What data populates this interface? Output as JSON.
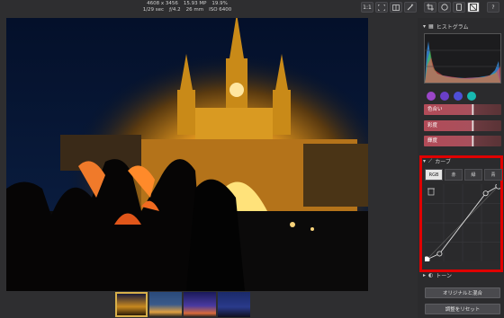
{
  "info": {
    "dimensions": "4608 x 3456",
    "megapixels": "15.93 MP",
    "zoom_percent": "19.9%",
    "shutter": "1/29 sec",
    "aperture": "ƒ/4.2",
    "focal": "26 mm",
    "iso": "ISO 6400"
  },
  "toolbar": {
    "zoom_label": "1:1",
    "icons": [
      "fit-screen-icon",
      "compare-icon",
      "magic-wand-icon",
      "crop-icon",
      "circle-mask-icon",
      "rect-mask-icon",
      "adjust-panel-icon",
      "help-icon"
    ]
  },
  "panel": {
    "histogram_title": "ヒストグラム",
    "color_swatches": [
      "#9b46c8",
      "#6a3fc8",
      "#4e4fd8",
      "#17b8b0"
    ],
    "adjustments": [
      {
        "label": "色合い"
      },
      {
        "label": "彩度"
      },
      {
        "label": "輝度"
      }
    ],
    "curve_title": "カーブ",
    "curve_tabs": [
      "RGB",
      "赤",
      "緑",
      "青"
    ],
    "curve_points": [
      [
        0,
        0
      ],
      [
        0.18,
        0.08
      ],
      [
        0.82,
        0.9
      ],
      [
        1,
        1
      ]
    ],
    "tone_title": "トーン",
    "blend_button": "オリジナルと混合",
    "reset_button": "調整をリセット"
  },
  "filmstrip": {
    "thumbs": [
      "thumb-basilica-night",
      "thumb-city-dusk",
      "thumb-night-sky",
      "thumb-sunset-blue"
    ],
    "active_index": 0
  },
  "colors": {
    "accent_highlight": "#e00000",
    "panel_bg": "#2b2b2d",
    "adjust_bar": "#b24b58"
  }
}
